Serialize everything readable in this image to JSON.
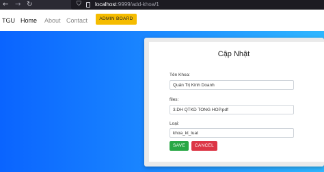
{
  "browser": {
    "url_host": "localhost",
    "url_path": ":9999/add-khoa/1",
    "icons": [
      "back-icon",
      "forward-icon",
      "reload-icon",
      "shield-icon",
      "page-icon"
    ]
  },
  "navbar": {
    "brand": "TGU",
    "links": [
      "Home",
      "About",
      "Contact"
    ],
    "admin_button": "ADMIN BOARD"
  },
  "form": {
    "title": "Cập Nhật",
    "ten_khoa": {
      "label": "Tên Khoa:",
      "value": "Quản Trị Kinh Doanh"
    },
    "files": {
      "label": "files:",
      "value": "3.DH QTKD TONG HOP.pdf"
    },
    "loai": {
      "label": "Loại:",
      "value": "khoa_kt_luat"
    },
    "save_label": "SAVE",
    "cancel_label": "CANCEL"
  },
  "colors": {
    "admin_button": "#f5bc00",
    "save_button": "#28a745",
    "cancel_button": "#dc3545",
    "gradient_start": "#0a64ff",
    "gradient_end": "#2fb7ff"
  }
}
